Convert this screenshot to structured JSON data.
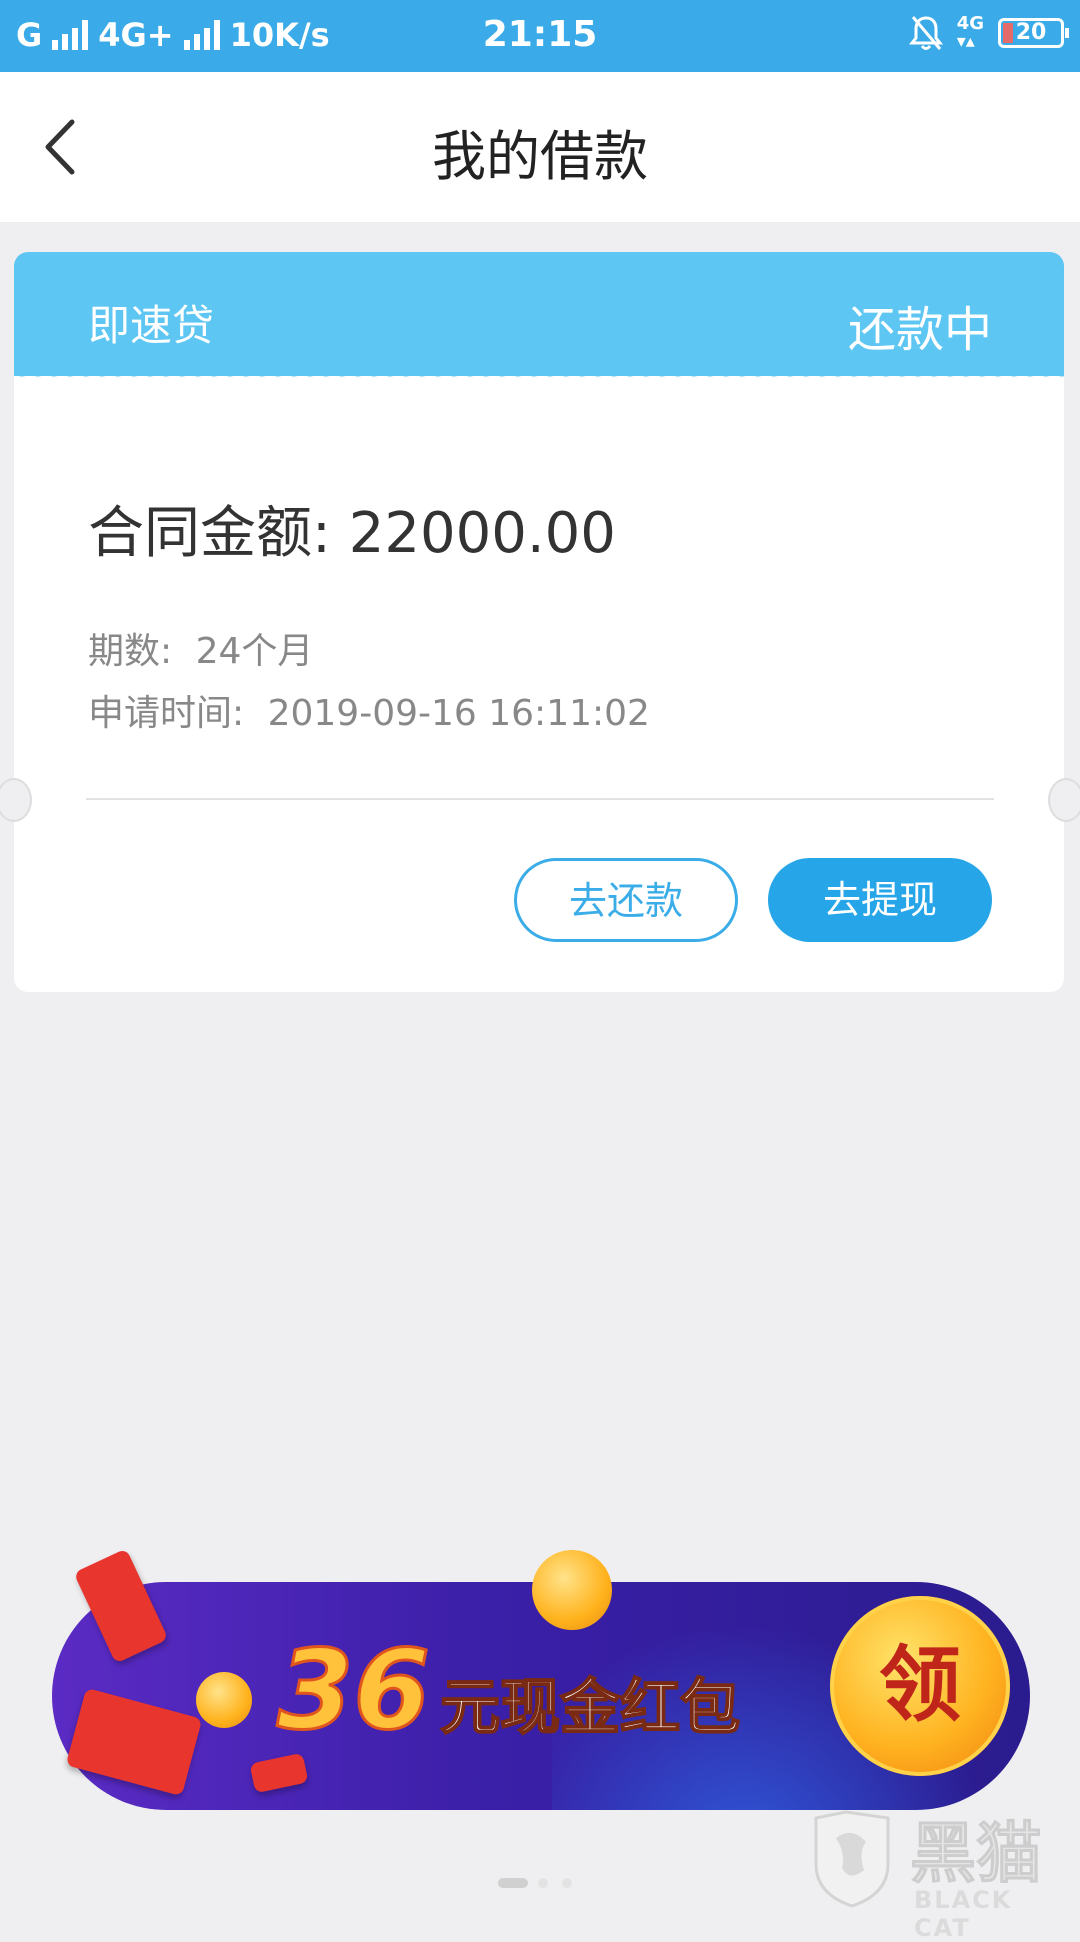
{
  "status_bar": {
    "carrier_1": "G",
    "carrier_2": "4G+",
    "speed": "10K/s",
    "time": "21:15",
    "net_badge": "4G",
    "battery_level": "20"
  },
  "header": {
    "title": "我的借款"
  },
  "loan_card": {
    "product": "即速贷",
    "status": "还款中",
    "amount_label": "合同金额:",
    "amount_value": "22000.00",
    "terms_label": "期数:",
    "terms_value": "24个月",
    "apply_label": "申请时间:",
    "apply_value": "2019-09-16 16:11:02",
    "repay_button": "去还款",
    "withdraw_button": "去提现"
  },
  "banner": {
    "amount": "36",
    "text": "元现金红包",
    "claim": "领"
  },
  "pager": {
    "total": 3,
    "active_index": 0
  },
  "watermark": {
    "brand_cn": "黑猫",
    "brand_en": "BLACK CAT"
  },
  "colors": {
    "status_bar": "#3aabe8",
    "card_header": "#5ec6f2",
    "button_primary": "#26a6e8",
    "background": "#efeff1"
  },
  "icons": {
    "back": "chevron-left-icon",
    "mute": "bell-off-icon"
  }
}
